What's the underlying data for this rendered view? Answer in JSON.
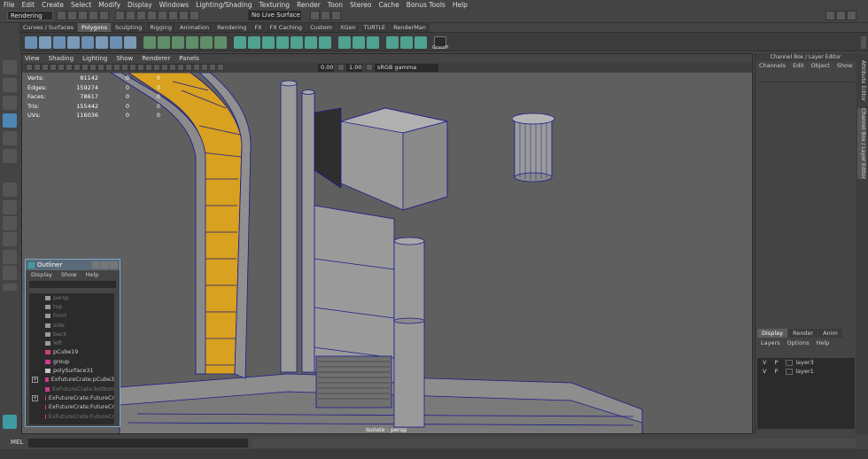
{
  "menubar": [
    "File",
    "Edit",
    "Create",
    "Select",
    "Modify",
    "Display",
    "Windows",
    "Lighting/Shading",
    "Texturing",
    "Render",
    "Toon",
    "Stereo",
    "Cache",
    "Bonus Tools",
    "Help"
  ],
  "status": {
    "mode": "Rendering",
    "live": "No Live Surface"
  },
  "shelf_tabs": [
    "Curves / Surfaces",
    "Polygons",
    "Sculpting",
    "Rigging",
    "Animation",
    "Rendering",
    "FX",
    "FX Caching",
    "Custom",
    "XGen",
    "TURTLE",
    "RenderMan"
  ],
  "shelf_active": "Polygons",
  "shelf_last_label": "GrassPi",
  "viewport": {
    "menus": [
      "View",
      "Shading",
      "Lighting",
      "Show",
      "Renderer",
      "Panels"
    ],
    "num1": "0.00",
    "num2": "1.00",
    "colorspace": "sRGB gamma",
    "isolate": "Isolate : persp"
  },
  "hud": [
    {
      "label": "Verts:",
      "v1": "81142",
      "v2": "0",
      "v3": "0"
    },
    {
      "label": "Edges:",
      "v1": "159274",
      "v2": "0",
      "v3": "0"
    },
    {
      "label": "Faces:",
      "v1": "78617",
      "v2": "0",
      "v3": "0"
    },
    {
      "label": "Tris:",
      "v1": "155442",
      "v2": "0",
      "v3": "0"
    },
    {
      "label": "UVs:",
      "v1": "116036",
      "v2": "0",
      "v3": "0"
    }
  ],
  "outliner": {
    "title": "Outliner",
    "menus": [
      "Display",
      "Show",
      "Help"
    ],
    "items": [
      {
        "label": "persp",
        "type": "camera",
        "dim": true,
        "plus": false
      },
      {
        "label": "top",
        "type": "camera",
        "dim": true,
        "plus": false
      },
      {
        "label": "front",
        "type": "camera",
        "dim": true,
        "plus": false
      },
      {
        "label": "side",
        "type": "camera",
        "dim": true,
        "plus": false
      },
      {
        "label": "back",
        "type": "camera",
        "dim": true,
        "plus": false
      },
      {
        "label": "left",
        "type": "camera",
        "dim": true,
        "plus": false
      },
      {
        "label": "pCube19",
        "type": "mesh",
        "dim": false,
        "plus": false
      },
      {
        "label": "group",
        "type": "mesh",
        "dim": false,
        "plus": false
      },
      {
        "label": "polySurface31",
        "type": "group",
        "dim": false,
        "plus": false
      },
      {
        "label": "ExFutureCrate:pCube3",
        "type": "mesh",
        "dim": false,
        "plus": true
      },
      {
        "label": "ExFutureCrate:bottom",
        "type": "mesh",
        "dim": true,
        "plus": false
      },
      {
        "label": "ExFutureCrate:FutureCr",
        "type": "mesh",
        "dim": false,
        "plus": true
      },
      {
        "label": "ExFutureCrate:FutureCr",
        "type": "mesh",
        "dim": false,
        "plus": false
      },
      {
        "label": "ExFutureCrate:FutureCr",
        "type": "mesh",
        "dim": true,
        "plus": false
      }
    ]
  },
  "channelbox": {
    "header": "Channel Box / Layer Editor",
    "menus": [
      "Channels",
      "Edit",
      "Object",
      "Show"
    ],
    "layer_tabs": [
      "Display",
      "Render",
      "Anim"
    ],
    "layer_tab_active": "Display",
    "layer_menus": [
      "Layers",
      "Options",
      "Help"
    ],
    "layers": [
      {
        "v": "V",
        "p": "P",
        "name": "layer3"
      },
      {
        "v": "V",
        "p": "P",
        "name": "layer1"
      }
    ]
  },
  "side_tabs": [
    "Attribute Editor",
    "Channel Box / Layer Editor"
  ],
  "cmd": {
    "label": "MEL"
  },
  "colors": {
    "wire": "#1a1a8c",
    "mesh": "#9a9a9a",
    "accent": "#d8a11f",
    "viewport": "#5f5f5f"
  }
}
